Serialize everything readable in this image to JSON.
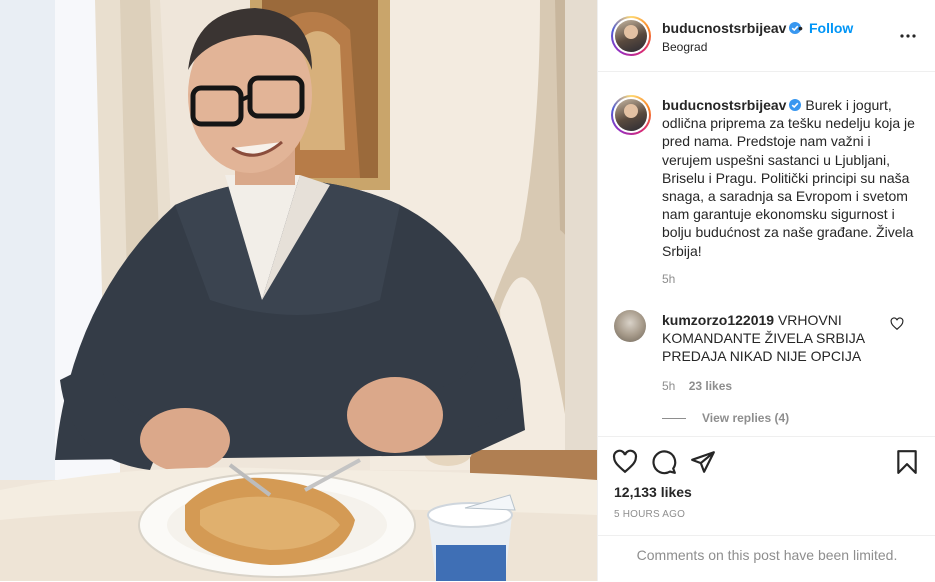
{
  "post": {
    "username": "buducnostsrbijeav",
    "follow_label": "Follow",
    "separator": "•",
    "location": "Beograd",
    "more_icon": "more-options-icon",
    "verified_icon": "verified-badge-icon"
  },
  "caption": {
    "username": "buducnostsrbijeav",
    "text": "Burek i jogurt, odlična priprema za tešku nedelju koja je pred nama. Predstoje nam važni i verujem uspešni sastanci u Ljubljani, Briselu i Pragu. Politički principi su naša snaga, a saradnja sa Evropom i svetom nam garantuje ekonomsku sigurnost i bolju budućnost za naše građane. Živela Srbija!",
    "time": "5h"
  },
  "comment": {
    "username": "kumzorzo122019",
    "text": "VRHOVNI KOMANDANTE ŽIVELA SRBIJA PREDAJA NIKAD NIJE OPCIJA",
    "time": "5h",
    "likes": "23 likes",
    "view_replies": "View replies (4)"
  },
  "actions": {
    "likes_count": "12,133 likes",
    "posted_ago": "5 HOURS AGO",
    "comments_limited": "Comments on this post have been limited."
  },
  "colors": {
    "link_blue": "#0095f6",
    "muted_gray": "#8e8e8e",
    "text": "#262626",
    "border": "#efefef"
  }
}
